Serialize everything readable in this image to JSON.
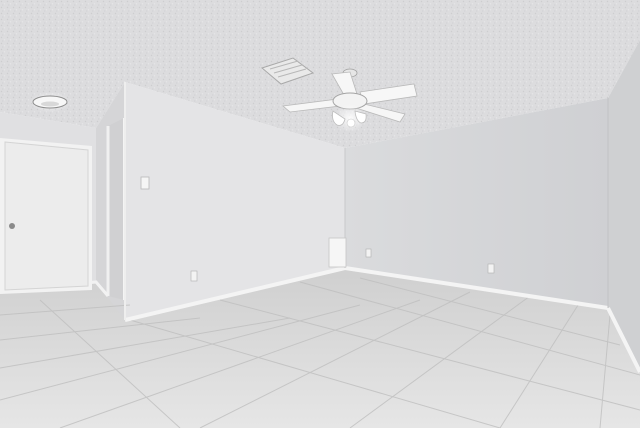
{
  "photo": {
    "subject": "",
    "palette": {
      "ceiling": "#dcdcde",
      "wall_left": "#e4e4e6",
      "wall_back": "#d7d8da",
      "wall_right": "#cfd0d2",
      "floor_light": "#e6e6e6",
      "floor_dark": "#cfcfcf",
      "grout": "#b9b9b9",
      "trim": "#f2f2f2",
      "door": "#ececec",
      "fan_blade": "#f7f7f7"
    },
    "elements": [
      "ceiling",
      "ceiling-fan",
      "air-vent",
      "ceiling-light",
      "entry-door",
      "hallway-opening",
      "light-switch",
      "wall-vent",
      "outlet",
      "baseboard",
      "tile-floor"
    ]
  }
}
